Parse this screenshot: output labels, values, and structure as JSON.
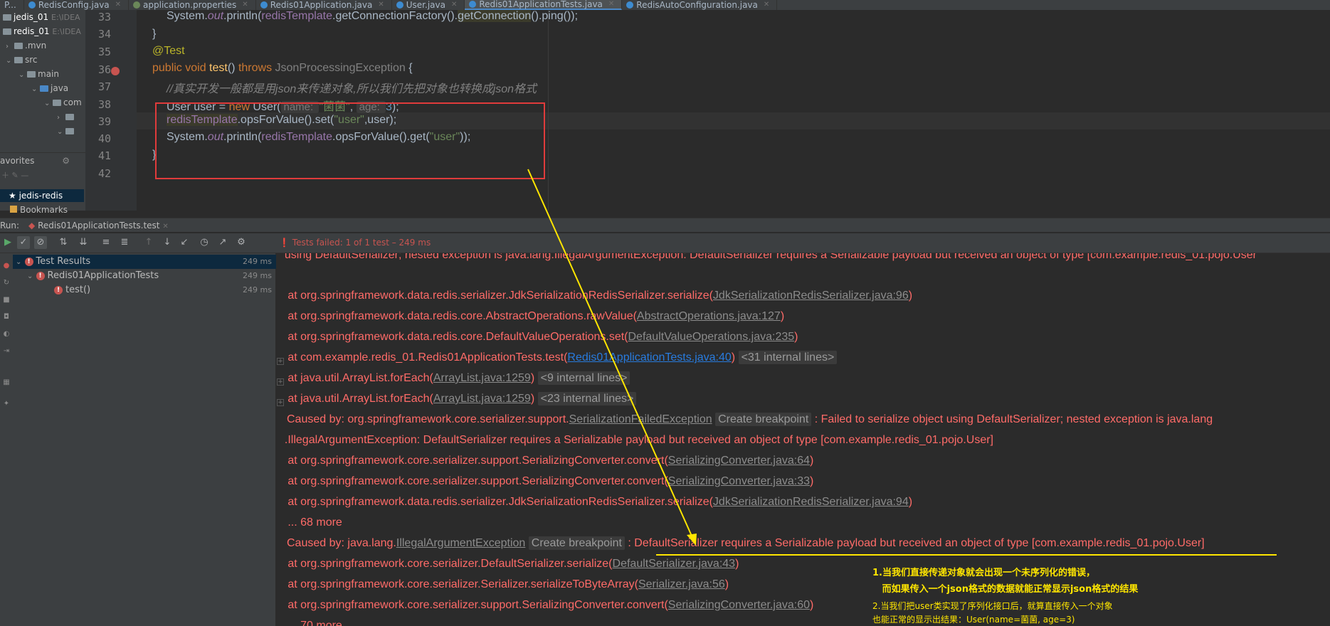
{
  "tabs": [
    {
      "label": "P..."
    },
    {
      "label": "RedisConfig.java"
    },
    {
      "label": "application.properties"
    },
    {
      "label": "Redis01Application.java"
    },
    {
      "label": "User.java"
    },
    {
      "label": "Redis01ApplicationTests.java"
    },
    {
      "label": "RedisAutoConfiguration.java"
    }
  ],
  "project": {
    "items": [
      {
        "label": "jedis_01",
        "path": "E:\\IDEA"
      },
      {
        "label": "redis_01",
        "path": "E:\\IDEA"
      },
      {
        "label": ".mvn"
      },
      {
        "label": "src"
      },
      {
        "label": "main"
      },
      {
        "label": "java"
      },
      {
        "label": "com"
      }
    ],
    "favorites_label": "avorites",
    "favorite_item": "jedis-redis",
    "bookmarks_label": "Bookmarks"
  },
  "editor": {
    "line_numbers": [
      "33",
      "34",
      "35",
      "36",
      "37",
      "38",
      "39",
      "40",
      "41",
      "42"
    ],
    "line33_a": "System.",
    "line33_out": "out",
    "line33_b": ".println(",
    "line33_field": "redisTemplate",
    "line33_c": ".getConnectionFactory().",
    "line33_d": "getConnection",
    "line33_e": "().ping());",
    "line34": "}",
    "line35": "@Test",
    "line36_kw": "public void ",
    "line36_fn": "test",
    "line36_mid": "() ",
    "line36_kw2": "throws ",
    "line36_exc": "JsonProcessingException",
    "line36_end": " {",
    "line37": "//真实开发一般都是用json来传递对象,所以我们先把对象也转换成json格式",
    "line38_a": "User user = ",
    "line38_new": "new ",
    "line38_b": "User(",
    "line38_hint1": "name: ",
    "line38_str": "\"菌菌\"",
    "line38_comma": ",",
    "line38_hint2": "age: ",
    "line38_num": "3",
    "line38_end": ");",
    "line39_field": "redisTemplate",
    "line39_a": ".opsForValue().set(",
    "line39_str": "\"user\"",
    "line39_b": ",user);",
    "line40_a": "System.",
    "line40_out": "out",
    "line40_b": ".println(",
    "line40_field": "redisTemplate",
    "line40_c": ".opsForValue().get(",
    "line40_str": "\"user\"",
    "line40_d": "));",
    "line41": "}"
  },
  "run": {
    "label": "Run:",
    "tab": "Redis01ApplicationTests.test",
    "status": "Tests failed: 1 of 1 test – 249 ms"
  },
  "tests": {
    "root": "Test Results",
    "root_time": "249 ms",
    "class": "Redis01ApplicationTests",
    "class_time": "249 ms",
    "method": "test()",
    "method_time": "249 ms"
  },
  "console": {
    "l0": "  using DefaultSerializer; nested exception is java.lang.IllegalArgumentException: DefaultSerializer requires a Serializable payload but received an object of type [com.example.redis_01.pojo.User",
    "l1_a": "   at org.springframework.data.redis.serializer.JdkSerializationRedisSerializer.serialize(",
    "l1_link": "JdkSerializationRedisSerializer.java:96",
    "l1_b": ")",
    "l2_a": "   at org.springframework.data.redis.core.AbstractOperations.rawValue(",
    "l2_link": "AbstractOperations.java:127",
    "l2_b": ")",
    "l3_a": "   at org.springframework.data.redis.core.DefaultValueOperations.set(",
    "l3_link": "DefaultValueOperations.java:235",
    "l3_b": ")",
    "l4_a": "   at com.example.redis_01.Redis01ApplicationTests.test(",
    "l4_link": "Redis01ApplicationTests.java:40",
    "l4_b": ") ",
    "l4_fold": "<31 internal lines>",
    "l5_a": "   at java.util.ArrayList.forEach(",
    "l5_link": "ArrayList.java:1259",
    "l5_b": ") ",
    "l5_fold": "<9 internal lines>",
    "l6_a": "   at java.util.ArrayList.forEach(",
    "l6_link": "ArrayList.java:1259",
    "l6_b": ") ",
    "l6_fold": "<23 internal lines>",
    "l7_a": "Caused by: org.springframework.core.serializer.support.",
    "l7_link": "SerializationFailedException",
    "l7_bp": "Create breakpoint",
    "l7_b": " : Failed to serialize object using DefaultSerializer; nested exception is java.lang",
    "l8": "  .IllegalArgumentException: DefaultSerializer requires a Serializable payload but received an object of type [com.example.redis_01.pojo.User]",
    "l9_a": "   at org.springframework.core.serializer.support.SerializingConverter.convert(",
    "l9_link": "SerializingConverter.java:64",
    "l9_b": ")",
    "l10_a": "   at org.springframework.core.serializer.support.SerializingConverter.convert(",
    "l10_link": "SerializingConverter.java:33",
    "l10_b": ")",
    "l11_a": "   at org.springframework.data.redis.serializer.JdkSerializationRedisSerializer.serialize(",
    "l11_link": "JdkSerializationRedisSerializer.java:94",
    "l11_b": ")",
    "l12": "   ... 68 more",
    "l13_a": "Caused by: java.lang.",
    "l13_link": "IllegalArgumentException",
    "l13_bp": "Create breakpoint",
    "l13_b": " : DefaultSerializer requires a Serializable payload but received an object of type [com.example.redis_01.pojo.User]",
    "l14_a": "   at org.springframework.core.serializer.DefaultSerializer.serialize(",
    "l14_link": "DefaultSerializer.java:43",
    "l14_b": ")",
    "l15_a": "   at org.springframework.core.serializer.Serializer.serializeToByteArray(",
    "l15_link": "Serializer.java:56",
    "l15_b": ")",
    "l16_a": "   at org.springframework.core.serializer.support.SerializingConverter.convert(",
    "l16_link": "SerializingConverter.java:60",
    "l16_b": ")",
    "l17": "   ... 70 more"
  },
  "annotations": {
    "note1_line1": "1.当我们直接传递对象就会出现一个未序列化的错误，",
    "note1_line2": "   而如果传入一个json格式的数据就能正常显示json格式的结果",
    "note2_line1": "2.当我们把user类实现了序列化接口后，就算直接传入一个对象",
    "note2_line2": "也能正常的显示出结果：User(name=菌菌, age=3)",
    "color": "#ffe600"
  }
}
